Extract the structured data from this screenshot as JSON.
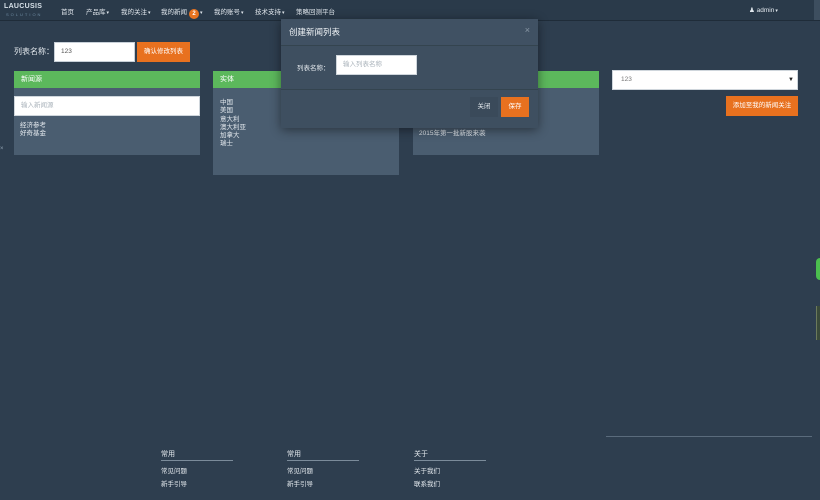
{
  "brand": {
    "line1": "LAUCUSIS",
    "line2": "SOLUTION"
  },
  "nav": {
    "home": "首页",
    "products": "产品库",
    "my_follow": "我的关注",
    "my_news": "我的新闻",
    "news_badge": "2",
    "my_account": "我的账号",
    "tech_support": "技术支持",
    "strategy_platform": "策略回测平台",
    "user": "admin"
  },
  "list_name": {
    "label": "列表名称：",
    "value": "123",
    "confirm_button": "确认修改列表"
  },
  "news_source_panel": {
    "title": "新闻源",
    "input_placeholder": "输入新闻源",
    "items": [
      "经济参考",
      "好奇基金"
    ]
  },
  "entity_panel": {
    "title": "实体",
    "items": [
      "中国",
      "美国",
      "意大利",
      "澳大利亚",
      "加拿大",
      "瑞士"
    ]
  },
  "news_panel": {
    "title": "",
    "items": [
      "2015年第一批新股来袭"
    ]
  },
  "right": {
    "select_value": "123",
    "add_follow_button": "添加至我的新闻关注"
  },
  "footer": [
    {
      "heading": "常用",
      "links": [
        "常见问题",
        "新手引导"
      ]
    },
    {
      "heading": "常用",
      "links": [
        "常见问题",
        "新手引导"
      ]
    },
    {
      "heading": "关于",
      "links": [
        "关于我们",
        "联系我们"
      ]
    }
  ],
  "modal": {
    "title": "创建新闻列表",
    "close_icon": "×",
    "field_label": "列表名称：",
    "field_placeholder": "输入列表名称",
    "close_button": "关闭",
    "save_button": "保存"
  },
  "colors": {
    "background": "#2e3e4f",
    "panel": "#4a5d70",
    "panel_header": "#5cb85c",
    "accent": "#e8711f",
    "modal": "#3e4f60"
  }
}
